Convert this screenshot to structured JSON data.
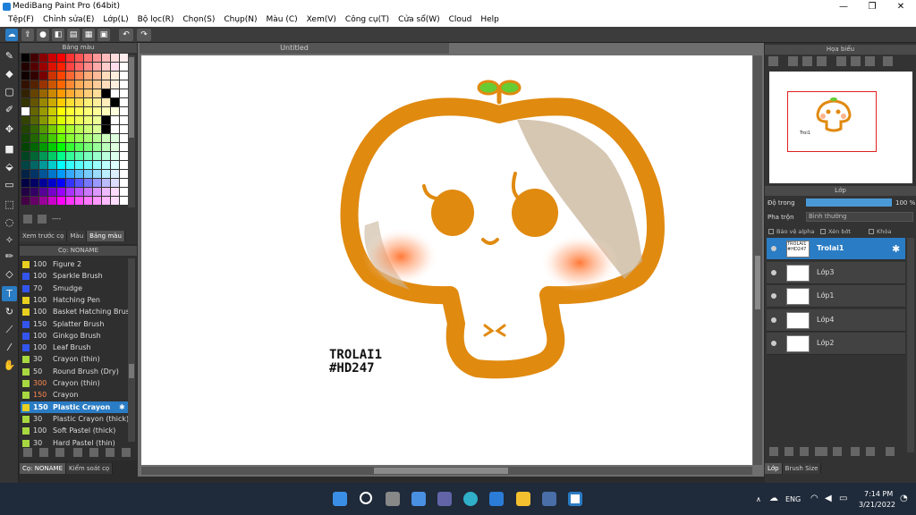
{
  "window": {
    "title": "MediBang Paint Pro (64bit)",
    "minimize": "—",
    "maximize": "❐",
    "close": "✕"
  },
  "menu": [
    "Tệp(F)",
    "Chỉnh sửa(E)",
    "Lớp(L)",
    "Bộ lọc(R)",
    "Chọn(S)",
    "Chụp(N)",
    "Màu (C)",
    "Xem(V)",
    "Công cụ(T)",
    "Cửa sổ(W)",
    "Cloud",
    "Help"
  ],
  "palette_panel": {
    "title": "Bảng màu",
    "footer_text": "----"
  },
  "palette_tabs": [
    "Xem trước cọ",
    "Màu",
    "Bảng màu"
  ],
  "brush_panel": {
    "title": "Cọ: NONAME",
    "brushes": [
      {
        "size": "100",
        "name": "Figure 2",
        "color": "#e8d020"
      },
      {
        "size": "100",
        "name": "Sparkle Brush",
        "color": "#3355ee"
      },
      {
        "size": "70",
        "name": "Smudge",
        "color": "#3355ee"
      },
      {
        "size": "100",
        "name": "Hatching Pen",
        "color": "#e8d020"
      },
      {
        "size": "100",
        "name": "Basket Hatching Brush",
        "color": "#e8d020"
      },
      {
        "size": "150",
        "name": "Splatter Brush",
        "color": "#3355ee"
      },
      {
        "size": "100",
        "name": "Ginkgo Brush",
        "color": "#3355ee"
      },
      {
        "size": "100",
        "name": "Leaf Brush",
        "color": "#3355ee"
      },
      {
        "size": "30",
        "name": "Crayon (thin)",
        "color": "#a8d840"
      },
      {
        "size": "50",
        "name": "Round Brush (Dry)",
        "color": "#a8d840"
      },
      {
        "size": "300",
        "name": "Crayon (thin)",
        "color": "#a8d840"
      },
      {
        "size": "150",
        "name": "Crayon",
        "color": "#a8d840"
      },
      {
        "size": "150",
        "name": "Plastic Crayon",
        "color": "#e8d020"
      },
      {
        "size": "30",
        "name": "Plastic Crayon (thick)",
        "color": "#a8d840"
      },
      {
        "size": "100",
        "name": "Soft Pastel (thick)",
        "color": "#a8d840"
      },
      {
        "size": "30",
        "name": "Hard Pastel (thin)",
        "color": "#a8d840"
      }
    ]
  },
  "brush_tabs": [
    "Cọ: NONAME",
    "Kiểm soát cọ"
  ],
  "canvas": {
    "title": "Untitled",
    "text_line1": "TROLAI1",
    "text_line2": "#HD247"
  },
  "navigator": {
    "title": "Họa biểu",
    "thumb_text": "Troi1"
  },
  "layer_panel": {
    "title": "Lớp",
    "opacity_label": "Độ trong",
    "opacity_value": "100 %",
    "blend_label": "Pha trộn",
    "blend_value": "Bình thường",
    "opacity_fraction": 1.0,
    "checks": [
      "Bảo vệ alpha",
      "Xén bớt",
      "Khóa"
    ],
    "layers": [
      {
        "name": "Trolai1",
        "thumb": "TROLAI1 #HD247",
        "selected": true
      },
      {
        "name": "Lớp3",
        "thumb": "",
        "selected": false
      },
      {
        "name": "Lớp1",
        "thumb": "",
        "selected": false
      },
      {
        "name": "Lớp4",
        "thumb": "",
        "selected": false
      },
      {
        "name": "Lớp2",
        "thumb": "",
        "selected": false
      }
    ]
  },
  "right_tabs": [
    "Lớp",
    "Brush Size"
  ],
  "taskbar": {
    "lang": "ENG",
    "time": "7:14 PM",
    "date": "3/21/2022"
  },
  "colors": {
    "accent": "#2a7cc4",
    "mushroom": "#e08a10",
    "cheek": "#ff7030",
    "sprout": "#66cc33"
  }
}
